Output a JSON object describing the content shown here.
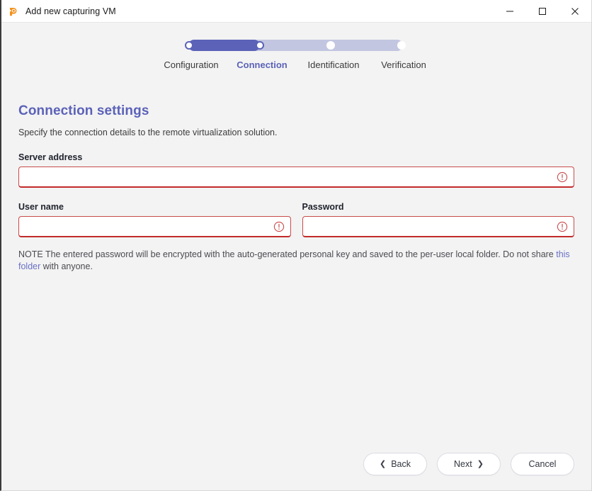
{
  "window": {
    "title": "Add new capturing VM",
    "app_icon": "app-logo-icon",
    "controls": {
      "minimize": "minimize-icon",
      "maximize": "maximize-icon",
      "close": "close-icon"
    }
  },
  "stepper": {
    "steps": [
      {
        "label": "Configuration",
        "state": "completed"
      },
      {
        "label": "Connection",
        "state": "current"
      },
      {
        "label": "Identification",
        "state": "upcoming"
      },
      {
        "label": "Verification",
        "state": "upcoming"
      }
    ],
    "active_index": 1,
    "colors": {
      "active": "#5b62b8",
      "track": "#c2c6e0"
    }
  },
  "page": {
    "title": "Connection settings",
    "subtitle": "Specify the connection details to the remote virtualization solution.",
    "fields": {
      "server_address": {
        "label": "Server address",
        "value": "",
        "placeholder": "",
        "error_icon": "error-exclamation-icon",
        "invalid": true
      },
      "user_name": {
        "label": "User name",
        "value": "",
        "placeholder": "",
        "error_icon": "error-exclamation-icon",
        "invalid": true
      },
      "password": {
        "label": "Password",
        "value": "",
        "placeholder": "",
        "error_icon": "error-exclamation-icon",
        "invalid": true
      }
    },
    "note": {
      "text_before": "NOTE The entered password will be encrypted with the auto-generated personal key and saved to the per-user local folder. Do not share ",
      "link_text": "this folder",
      "text_after": " with anyone."
    },
    "colors": {
      "heading": "#5b62b8",
      "error_border": "#c94b4b",
      "link": "#6a70c4"
    }
  },
  "footer": {
    "back": {
      "label": "Back",
      "icon": "chevron-left-icon"
    },
    "next": {
      "label": "Next",
      "icon": "chevron-right-icon"
    },
    "cancel": {
      "label": "Cancel"
    }
  }
}
